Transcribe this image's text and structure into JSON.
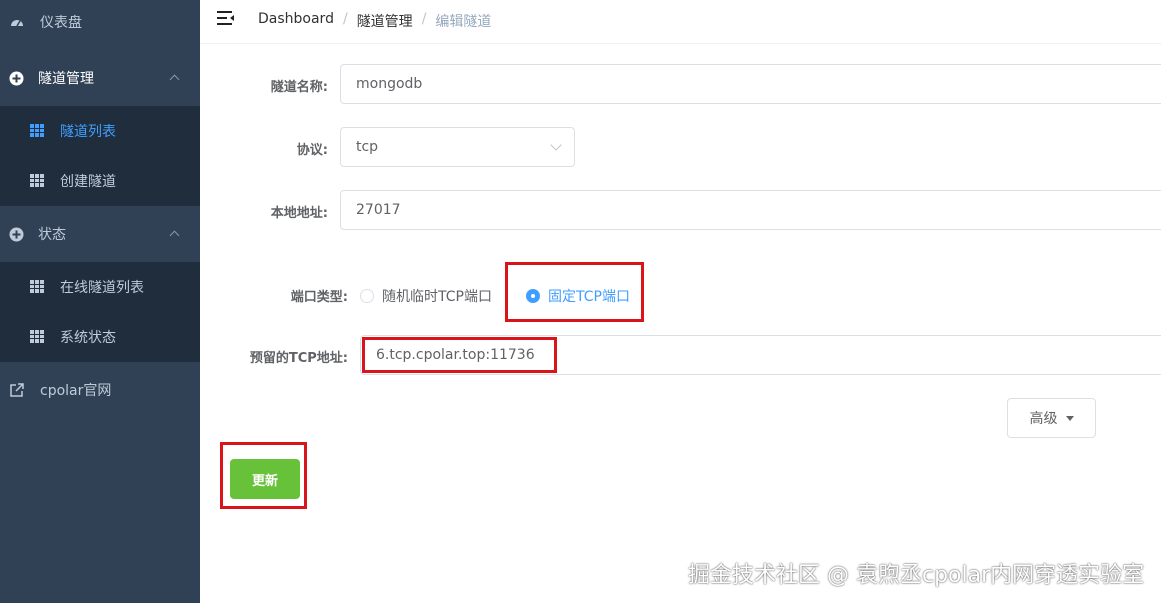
{
  "sidebar": {
    "items": [
      {
        "label": "仪表盘",
        "icon": "dashboard-icon"
      },
      {
        "label": "隧道管理",
        "icon": "circle-plus-icon",
        "children": [
          {
            "label": "隧道列表",
            "icon": "table-icon",
            "active": true
          },
          {
            "label": "创建隧道",
            "icon": "table-icon"
          }
        ]
      },
      {
        "label": "状态",
        "icon": "circle-plus-icon",
        "children": [
          {
            "label": "在线隧道列表",
            "icon": "table-icon"
          },
          {
            "label": "系统状态",
            "icon": "table-icon"
          }
        ]
      },
      {
        "label": "cpolar官网",
        "icon": "external-link-icon"
      }
    ]
  },
  "breadcrumb": {
    "home": "Dashboard",
    "section": "隧道管理",
    "current": "编辑隧道",
    "separator": "/"
  },
  "form": {
    "name_label": "隧道名称:",
    "name_value": "mongodb",
    "protocol_label": "协议:",
    "protocol_value": "tcp",
    "address_label": "本地地址:",
    "address_value": "27017",
    "port_type_label": "端口类型:",
    "port_options": [
      "随机临时TCP端口",
      "固定TCP端口"
    ],
    "port_selected": "固定TCP端口",
    "reserved_label": "预留的TCP地址:",
    "reserved_value": "6.tcp.cpolar.top:11736"
  },
  "buttons": {
    "advanced": "高级",
    "update": "更新"
  },
  "watermark": "掘金技术社区 @ 袁煦丞cpolar内网穿透实验室",
  "colors": {
    "sidebar_bg": "#304156",
    "submenu_bg": "#1f2d3d",
    "accent": "#409eff",
    "success": "#67c23a",
    "highlight_box": "#d9141b"
  }
}
